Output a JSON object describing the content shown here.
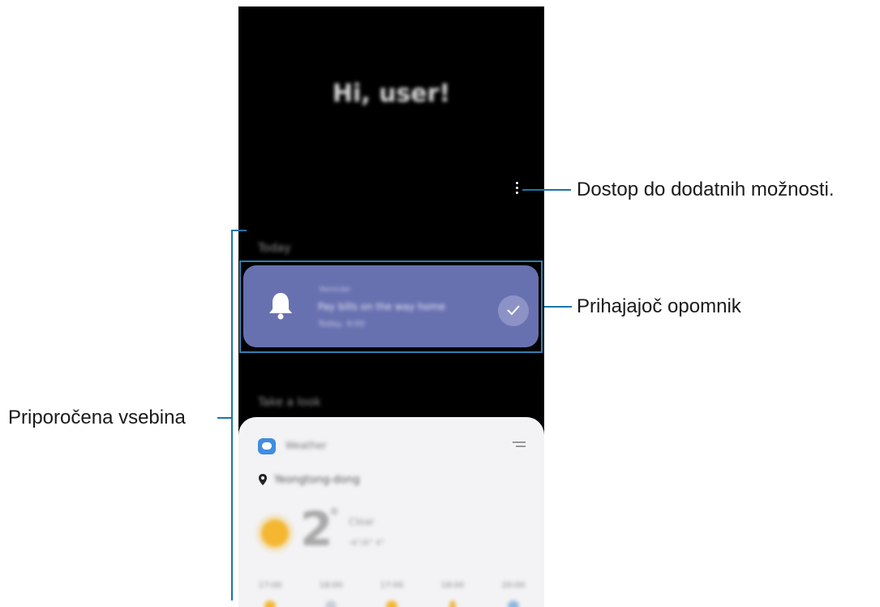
{
  "callouts": {
    "more_options": "Dostop do dodatnih možnosti.",
    "reminder": "Prihajajoč opomnik",
    "recommended": "Priporočena vsebina"
  },
  "screen": {
    "greeting": "Hi, user!",
    "section_today": "Today",
    "section_take_a_look": "Take a look",
    "reminder_card": {
      "category": "Reminder",
      "title": "Pay bills on the way home",
      "time": "Today, 9:00",
      "icons": [
        "bell-icon",
        "check-icon"
      ],
      "color": "#6871b0"
    },
    "weather_card": {
      "app_name": "Weather",
      "location": "Yeongtong-dong",
      "temperature": "2",
      "unit": "°",
      "condition": "Clear",
      "minmax": "-6°/6° 4°",
      "hours": [
        "17:00",
        "18:00",
        "17:00",
        "18:00",
        "20:00"
      ]
    }
  },
  "accent_color": "#1d74a8"
}
